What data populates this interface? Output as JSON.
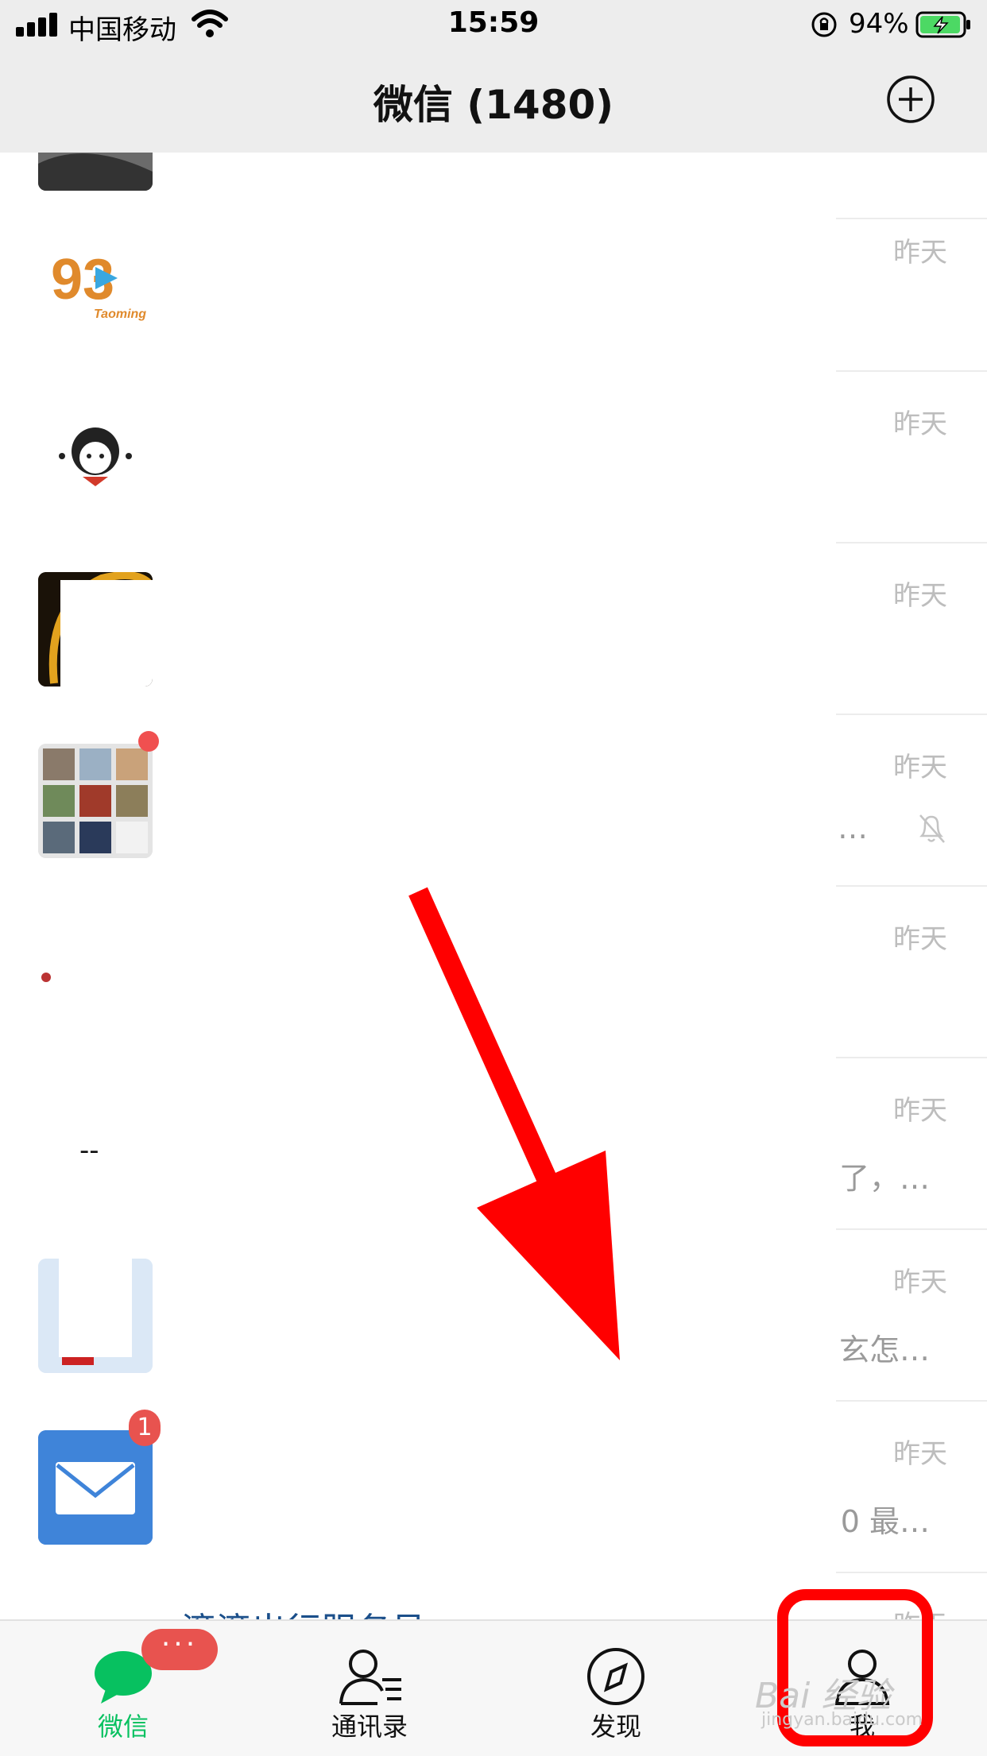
{
  "status_bar": {
    "carrier": "中国移动",
    "time": "15:59",
    "battery": "94%"
  },
  "nav": {
    "title": "微信 (1480)"
  },
  "chats": [
    {
      "time": "",
      "preview": ""
    },
    {
      "time": "昨天",
      "preview": ""
    },
    {
      "time": "昨天",
      "preview": ""
    },
    {
      "time": "昨天",
      "preview": ""
    },
    {
      "time": "昨天",
      "preview": "…",
      "muted": true,
      "badge": "dot"
    },
    {
      "time": "昨天",
      "preview": ""
    },
    {
      "time": "昨天",
      "preview": "了，…",
      "name": "--"
    },
    {
      "time": "昨天",
      "preview": "玄怎…"
    },
    {
      "time": "昨天",
      "preview": "0 最…",
      "badge": "1"
    },
    {
      "time": "昨天",
      "preview": "",
      "name": "滴滴出行服务号"
    }
  ],
  "avatar_logo": {
    "big": "93",
    "small": "Taoming"
  },
  "tabs": [
    {
      "label": "微信",
      "active": true,
      "badge": "···"
    },
    {
      "label": "通讯录"
    },
    {
      "label": "发现"
    },
    {
      "label": "我"
    }
  ],
  "watermark": {
    "main": "Bai 经验",
    "sub": "jingyan.baidu.com"
  },
  "colors": {
    "accent": "#07c160",
    "badge": "#e8534f",
    "annotation": "#ff0000"
  }
}
